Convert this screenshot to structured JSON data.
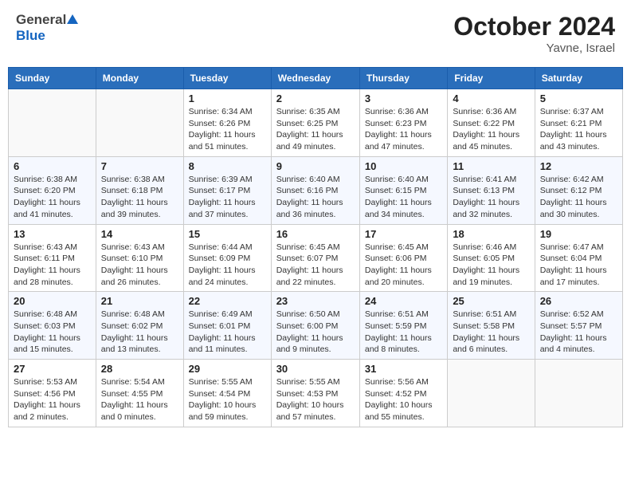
{
  "header": {
    "logo_general": "General",
    "logo_blue": "Blue",
    "month_title": "October 2024",
    "location": "Yavne, Israel"
  },
  "weekdays": [
    "Sunday",
    "Monday",
    "Tuesday",
    "Wednesday",
    "Thursday",
    "Friday",
    "Saturday"
  ],
  "weeks": [
    [
      {
        "day": "",
        "info": ""
      },
      {
        "day": "",
        "info": ""
      },
      {
        "day": "1",
        "info": "Sunrise: 6:34 AM\nSunset: 6:26 PM\nDaylight: 11 hours and 51 minutes."
      },
      {
        "day": "2",
        "info": "Sunrise: 6:35 AM\nSunset: 6:25 PM\nDaylight: 11 hours and 49 minutes."
      },
      {
        "day": "3",
        "info": "Sunrise: 6:36 AM\nSunset: 6:23 PM\nDaylight: 11 hours and 47 minutes."
      },
      {
        "day": "4",
        "info": "Sunrise: 6:36 AM\nSunset: 6:22 PM\nDaylight: 11 hours and 45 minutes."
      },
      {
        "day": "5",
        "info": "Sunrise: 6:37 AM\nSunset: 6:21 PM\nDaylight: 11 hours and 43 minutes."
      }
    ],
    [
      {
        "day": "6",
        "info": "Sunrise: 6:38 AM\nSunset: 6:20 PM\nDaylight: 11 hours and 41 minutes."
      },
      {
        "day": "7",
        "info": "Sunrise: 6:38 AM\nSunset: 6:18 PM\nDaylight: 11 hours and 39 minutes."
      },
      {
        "day": "8",
        "info": "Sunrise: 6:39 AM\nSunset: 6:17 PM\nDaylight: 11 hours and 37 minutes."
      },
      {
        "day": "9",
        "info": "Sunrise: 6:40 AM\nSunset: 6:16 PM\nDaylight: 11 hours and 36 minutes."
      },
      {
        "day": "10",
        "info": "Sunrise: 6:40 AM\nSunset: 6:15 PM\nDaylight: 11 hours and 34 minutes."
      },
      {
        "day": "11",
        "info": "Sunrise: 6:41 AM\nSunset: 6:13 PM\nDaylight: 11 hours and 32 minutes."
      },
      {
        "day": "12",
        "info": "Sunrise: 6:42 AM\nSunset: 6:12 PM\nDaylight: 11 hours and 30 minutes."
      }
    ],
    [
      {
        "day": "13",
        "info": "Sunrise: 6:43 AM\nSunset: 6:11 PM\nDaylight: 11 hours and 28 minutes."
      },
      {
        "day": "14",
        "info": "Sunrise: 6:43 AM\nSunset: 6:10 PM\nDaylight: 11 hours and 26 minutes."
      },
      {
        "day": "15",
        "info": "Sunrise: 6:44 AM\nSunset: 6:09 PM\nDaylight: 11 hours and 24 minutes."
      },
      {
        "day": "16",
        "info": "Sunrise: 6:45 AM\nSunset: 6:07 PM\nDaylight: 11 hours and 22 minutes."
      },
      {
        "day": "17",
        "info": "Sunrise: 6:45 AM\nSunset: 6:06 PM\nDaylight: 11 hours and 20 minutes."
      },
      {
        "day": "18",
        "info": "Sunrise: 6:46 AM\nSunset: 6:05 PM\nDaylight: 11 hours and 19 minutes."
      },
      {
        "day": "19",
        "info": "Sunrise: 6:47 AM\nSunset: 6:04 PM\nDaylight: 11 hours and 17 minutes."
      }
    ],
    [
      {
        "day": "20",
        "info": "Sunrise: 6:48 AM\nSunset: 6:03 PM\nDaylight: 11 hours and 15 minutes."
      },
      {
        "day": "21",
        "info": "Sunrise: 6:48 AM\nSunset: 6:02 PM\nDaylight: 11 hours and 13 minutes."
      },
      {
        "day": "22",
        "info": "Sunrise: 6:49 AM\nSunset: 6:01 PM\nDaylight: 11 hours and 11 minutes."
      },
      {
        "day": "23",
        "info": "Sunrise: 6:50 AM\nSunset: 6:00 PM\nDaylight: 11 hours and 9 minutes."
      },
      {
        "day": "24",
        "info": "Sunrise: 6:51 AM\nSunset: 5:59 PM\nDaylight: 11 hours and 8 minutes."
      },
      {
        "day": "25",
        "info": "Sunrise: 6:51 AM\nSunset: 5:58 PM\nDaylight: 11 hours and 6 minutes."
      },
      {
        "day": "26",
        "info": "Sunrise: 6:52 AM\nSunset: 5:57 PM\nDaylight: 11 hours and 4 minutes."
      }
    ],
    [
      {
        "day": "27",
        "info": "Sunrise: 5:53 AM\nSunset: 4:56 PM\nDaylight: 11 hours and 2 minutes."
      },
      {
        "day": "28",
        "info": "Sunrise: 5:54 AM\nSunset: 4:55 PM\nDaylight: 11 hours and 0 minutes."
      },
      {
        "day": "29",
        "info": "Sunrise: 5:55 AM\nSunset: 4:54 PM\nDaylight: 10 hours and 59 minutes."
      },
      {
        "day": "30",
        "info": "Sunrise: 5:55 AM\nSunset: 4:53 PM\nDaylight: 10 hours and 57 minutes."
      },
      {
        "day": "31",
        "info": "Sunrise: 5:56 AM\nSunset: 4:52 PM\nDaylight: 10 hours and 55 minutes."
      },
      {
        "day": "",
        "info": ""
      },
      {
        "day": "",
        "info": ""
      }
    ]
  ]
}
